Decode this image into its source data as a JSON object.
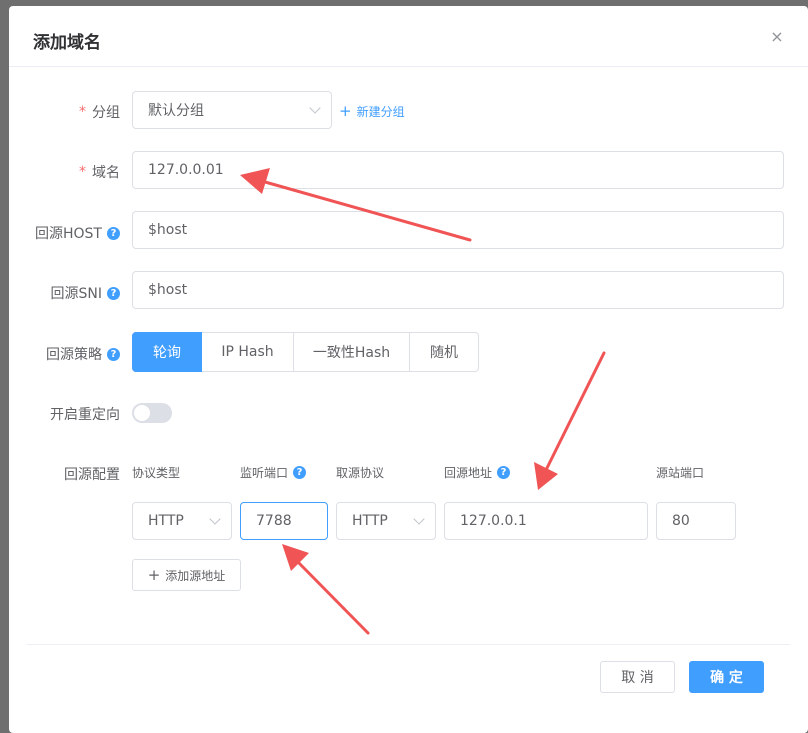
{
  "dialog": {
    "title": "添加域名",
    "close_glyph": "×"
  },
  "form": {
    "group": {
      "label": "分组",
      "value": "默认分组",
      "new_group_link": "新建分组"
    },
    "domain": {
      "label": "域名",
      "value": "127.0.0.01"
    },
    "origin_host": {
      "label": "回源HOST",
      "value": "$host"
    },
    "origin_sni": {
      "label": "回源SNI",
      "value": "$host"
    },
    "origin_strategy": {
      "label": "回源策略",
      "options": [
        "轮询",
        "IP Hash",
        "一致性Hash",
        "随机"
      ],
      "selected": "轮询"
    },
    "redirect": {
      "label": "开启重定向",
      "enabled": false
    },
    "origin_config": {
      "label": "回源配置",
      "columns": [
        "协议类型",
        "监听端口",
        "取源协议",
        "回源地址",
        "源站端口"
      ],
      "row": {
        "protocol": "HTTP",
        "listen_port": "7788",
        "fetch_protocol": "HTTP",
        "origin_address": "127.0.0.1",
        "origin_port": "80"
      },
      "add_origin_button": "添加源地址"
    }
  },
  "footer": {
    "cancel_label": "取 消",
    "confirm_label": "确 定"
  },
  "colors": {
    "primary": "#409eff",
    "required": "#f56c6c",
    "annotation_arrow": "#f05454"
  },
  "icons": [
    "close-icon",
    "chevron-down-icon",
    "plus-icon",
    "help-icon"
  ]
}
